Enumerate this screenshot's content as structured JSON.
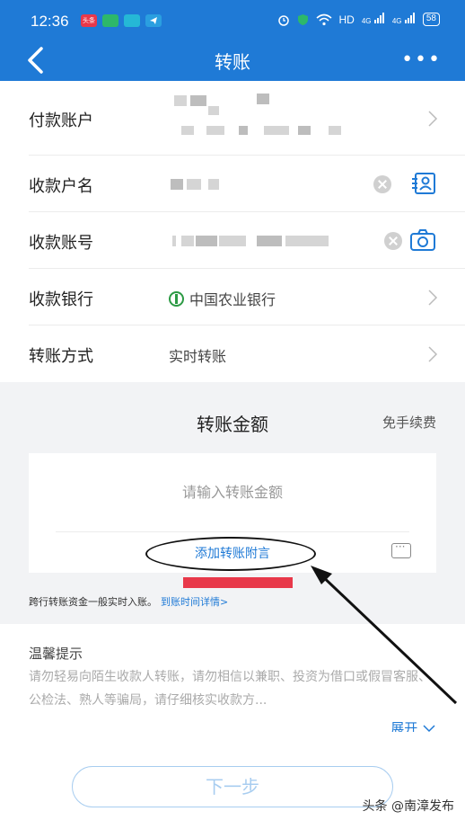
{
  "status_bar": {
    "time": "12:36",
    "apps": [
      {
        "icon": "toutiao-app-icon",
        "text": "头条",
        "color": "#e8384a"
      },
      {
        "icon": "gallery-app-icon",
        "text": "",
        "color": "#2db86a"
      },
      {
        "icon": "chat-app-icon",
        "text": "",
        "color": "#25b8d6"
      },
      {
        "icon": "telegram-app-icon",
        "text": "",
        "color": "#2a9fe0"
      }
    ],
    "network": "HD",
    "signal_1": "4G",
    "signal_2": "4G",
    "battery": "58"
  },
  "nav": {
    "title": "转账",
    "more": "•••"
  },
  "form": {
    "payer_label": "付款账户",
    "payee_name_label": "收款户名",
    "payee_account_label": "收款账号",
    "bank_label": "收款银行",
    "bank_value": "中国农业银行",
    "method_label": "转账方式",
    "method_value": "实时转账"
  },
  "amount": {
    "title": "转账金额",
    "fee": "免手续费",
    "placeholder": "请输入转账金额",
    "add_note": "添加转账附言"
  },
  "note": {
    "text": "跨行转账资金一般实时入账。",
    "link": "到账时间详情>"
  },
  "tips": {
    "title": "温馨提示",
    "text": "请勿轻易向陌生收款人转账，请勿相信以兼职、投资为借口或假冒客服、公检法、熟人等骗局，请仔细核实收款方...",
    "expand": "展开"
  },
  "footer": {
    "next": "下一步",
    "watermark": "头条 @南漳发布"
  },
  "colors": {
    "brand": "#1f7ad6",
    "annotation_red": "#e8384a",
    "bank_green": "#2c9a44"
  }
}
